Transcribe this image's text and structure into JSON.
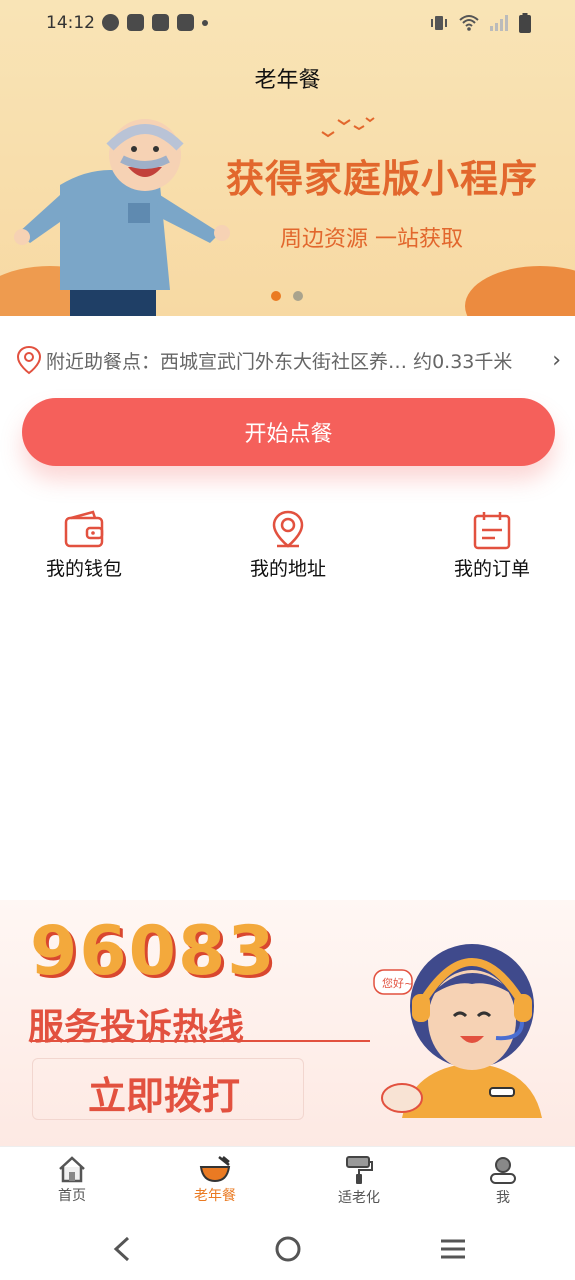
{
  "status_bar": {
    "time": "14:12"
  },
  "page": {
    "title": "老年餐"
  },
  "banner": {
    "slogan_main": "获得家庭版小程序",
    "slogan_sub": "周边资源 一站获取",
    "carousel_count": 2,
    "carousel_active": 1
  },
  "location": {
    "label": "附近助餐点：",
    "name": "西城宣武门外东大街社区养…",
    "distance": "约0.33千米"
  },
  "order_button": {
    "label": "开始点餐"
  },
  "quick_menu": [
    {
      "label": "我的钱包",
      "icon": "wallet-icon"
    },
    {
      "label": "我的地址",
      "icon": "location-icon"
    },
    {
      "label": "我的订单",
      "icon": "order-icon"
    }
  ],
  "hotline": {
    "number": "96083",
    "title": "服务投诉热线",
    "call_label": "立即拨打",
    "bubble": "您好~"
  },
  "tabbar": [
    {
      "label": "首页",
      "icon": "home-icon",
      "active": false
    },
    {
      "label": "老年餐",
      "icon": "bowl-icon",
      "active": true
    },
    {
      "label": "适老化",
      "icon": "paint-roller-icon",
      "active": false
    },
    {
      "label": "我",
      "icon": "user-icon",
      "active": false
    }
  ],
  "colors": {
    "accent": "#f5605b",
    "brand_orange": "#ea7a22",
    "banner_bg": "#f9e4b6",
    "hotline_red": "#e2513f",
    "hotline_yellow": "#f3a93c"
  }
}
